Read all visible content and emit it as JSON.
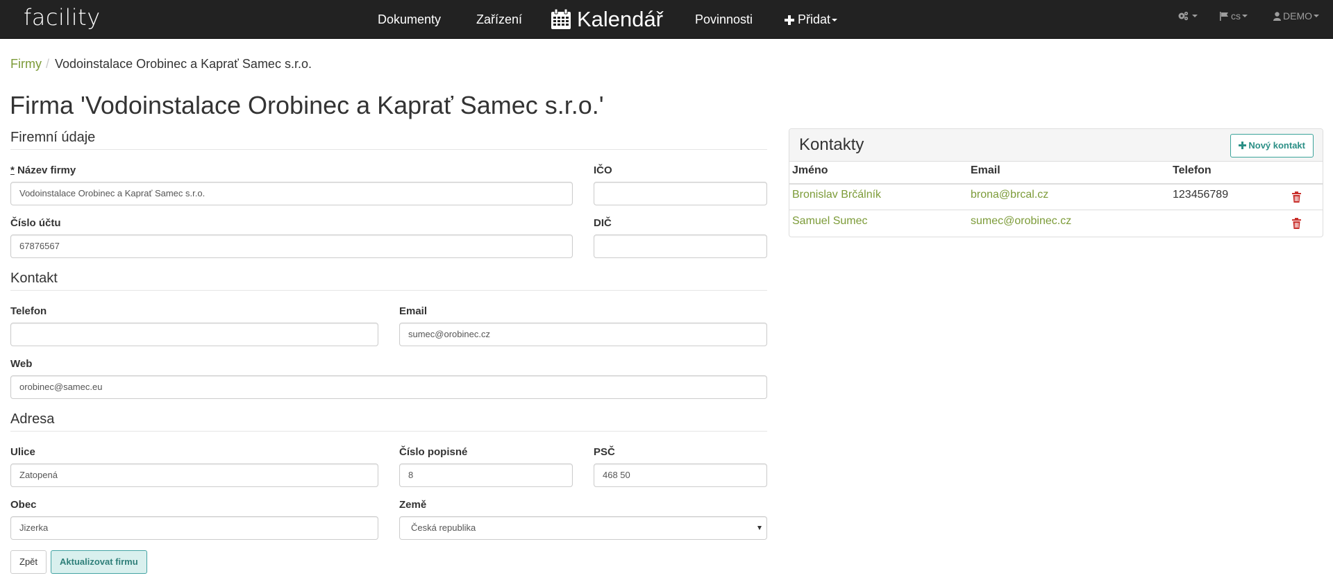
{
  "navbar": {
    "brand": "facility",
    "links": [
      "Dokumenty",
      "Zařízení",
      "Kalendář",
      "Povinnosti",
      "Přidat"
    ],
    "settings_icon": "cogs-icon",
    "language": "cs",
    "user": "DEMO"
  },
  "breadcrumb": {
    "parent": "Firmy",
    "current": "Vodoinstalace Orobinec a Kaprať Samec s.r.o."
  },
  "page_title": "Firma 'Vodoinstalace Orobinec a Kaprať Samec s.r.o.'",
  "company": {
    "section": "Firemní údaje",
    "name_label": "Název firmy",
    "name_required_mark": "*",
    "name_value": "Vodoinstalace Orobinec a Kaprať Samec s.r.o.",
    "ico_label": "IČO",
    "ico_value": "",
    "account_label": "Číslo účtu",
    "account_value": "67876567",
    "dic_label": "DIČ",
    "dic_value": ""
  },
  "contact": {
    "section": "Kontakt",
    "phone_label": "Telefon",
    "phone_value": "",
    "email_label": "Email",
    "email_value": "sumec@orobinec.cz",
    "web_label": "Web",
    "web_value": "orobinec@samec.eu"
  },
  "address": {
    "section": "Adresa",
    "street_label": "Ulice",
    "street_value": "Zatopená",
    "number_label": "Číslo popisné",
    "number_value": "8",
    "zip_label": "PSČ",
    "zip_value": "468 50",
    "city_label": "Obec",
    "city_value": "Jizerka",
    "country_label": "Země",
    "country_value": "Česká republika"
  },
  "buttons": {
    "back": "Zpět",
    "update": "Aktualizovat firmu"
  },
  "contacts_panel": {
    "title": "Kontakty",
    "new_button": "Nový kontakt",
    "columns": [
      "Jméno",
      "Email",
      "Telefon"
    ],
    "rows": [
      {
        "name": "Bronislav Brčálník",
        "email": "brona@brcal.cz",
        "phone": "123456789"
      },
      {
        "name": "Samuel Sumec",
        "email": "sumec@orobinec.cz",
        "phone": ""
      }
    ]
  },
  "colors": {
    "navbar": "#222222",
    "link": "#7c9b38",
    "accent": "#43a3a3",
    "delete": "#c9302c"
  }
}
